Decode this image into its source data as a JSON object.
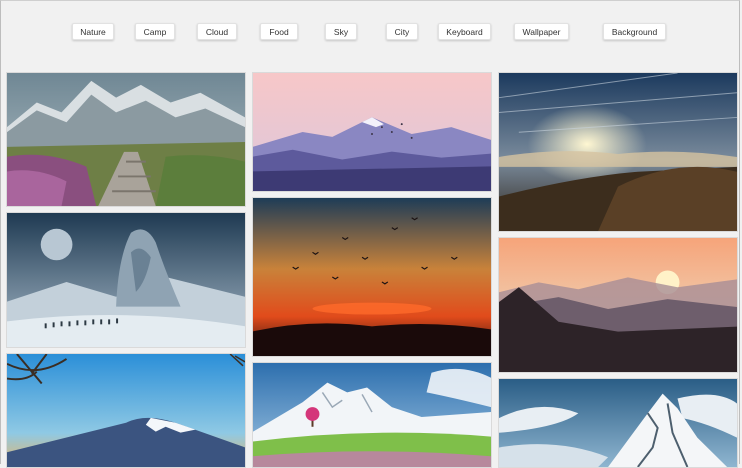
{
  "categories": [
    "Nature",
    "Camp",
    "Cloud",
    "Food",
    "Sky",
    "City",
    "Keyboard",
    "Wallpaper",
    "Background"
  ],
  "gallery": [
    {
      "subject": "mountain-path-heather"
    },
    {
      "subject": "fantasy-stone-giant-moon"
    },
    {
      "subject": "mount-fuji-branches"
    },
    {
      "subject": "purple-mountains-birds"
    },
    {
      "subject": "sunset-birds-silhouette"
    },
    {
      "subject": "snow-mountain-pink-tree"
    },
    {
      "subject": "sun-over-clouds-peak"
    },
    {
      "subject": "misty-mountain-sunrise"
    },
    {
      "subject": "snowy-summit-clouds"
    }
  ]
}
